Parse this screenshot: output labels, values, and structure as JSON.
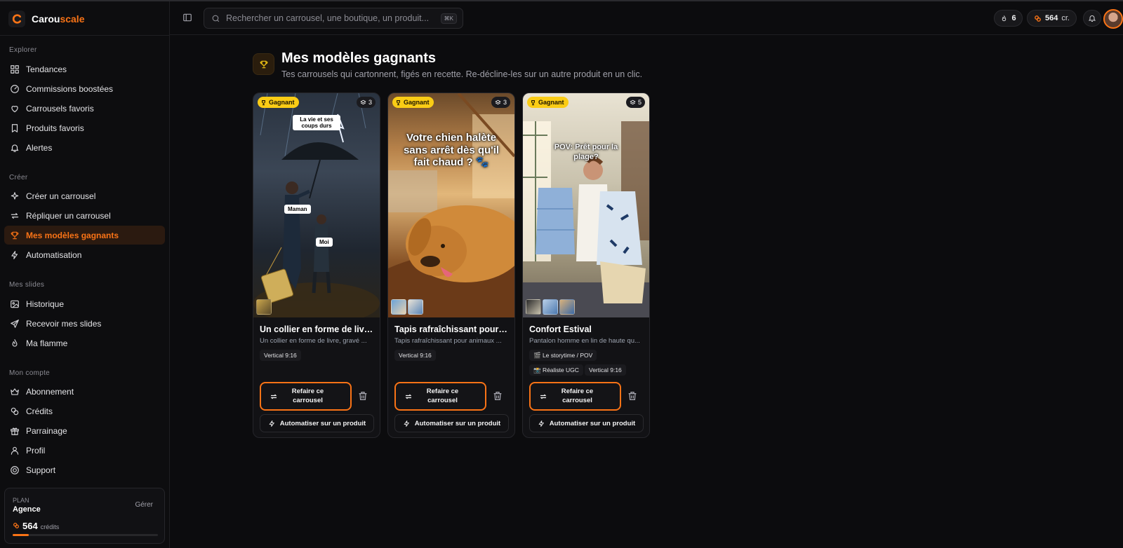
{
  "brand": {
    "name_a": "Carou",
    "name_b": "scale"
  },
  "search": {
    "placeholder": "Rechercher un carrousel, une boutique, un produit...",
    "shortcut": "⌘K"
  },
  "topbar": {
    "flame_count": "6",
    "credits": "564",
    "credits_unit": "cr."
  },
  "sidebar": {
    "sections": [
      {
        "title": "Explorer",
        "items": [
          {
            "label": "Tendances",
            "icon": "grid-icon"
          },
          {
            "label": "Commissions boostées",
            "icon": "gauge-icon"
          },
          {
            "label": "Carrousels favoris",
            "icon": "heart-icon"
          },
          {
            "label": "Produits favoris",
            "icon": "bookmark-icon"
          },
          {
            "label": "Alertes",
            "icon": "bell-icon"
          }
        ]
      },
      {
        "title": "Créer",
        "items": [
          {
            "label": "Créer un carrousel",
            "icon": "sparkles-icon"
          },
          {
            "label": "Répliquer un carrousel",
            "icon": "repeat-icon"
          },
          {
            "label": "Mes modèles gagnants",
            "icon": "trophy-icon",
            "active": true
          },
          {
            "label": "Automatisation",
            "icon": "bolt-icon"
          }
        ]
      },
      {
        "title": "Mes slides",
        "items": [
          {
            "label": "Historique",
            "icon": "image-icon"
          },
          {
            "label": "Recevoir mes slides",
            "icon": "send-icon"
          },
          {
            "label": "Ma flamme",
            "icon": "flame-icon"
          }
        ]
      },
      {
        "title": "Mon compte",
        "items": [
          {
            "label": "Abonnement",
            "icon": "crown-icon"
          },
          {
            "label": "Crédits",
            "icon": "coins-icon"
          },
          {
            "label": "Parrainage",
            "icon": "gift-icon"
          },
          {
            "label": "Profil",
            "icon": "user-icon"
          },
          {
            "label": "Support",
            "icon": "lifebuoy-icon"
          }
        ]
      }
    ]
  },
  "plan": {
    "label": "PLAN",
    "name": "Agence",
    "manage": "Gérer",
    "credits": "564",
    "credits_unit": "crédits",
    "credits_fill": 0.11
  },
  "page": {
    "title": "Mes modèles gagnants",
    "subtitle": "Tes carrousels qui cartonnent, figés en recette. Re-décline-les sur un autre produit en un clic."
  },
  "cards": [
    {
      "badge": "Gagnant",
      "slides": "3",
      "title": "Un collier en forme de livre...",
      "desc": "Un collier en forme de livre, gravé ...",
      "image_labels": [
        "La vie et ses coups durs",
        "Maman",
        "Moi"
      ],
      "chips": [
        {
          "label": "Vertical 9:16"
        }
      ],
      "redo": "Refaire ce carrousel",
      "auto": "Automatiser sur un produit"
    },
    {
      "badge": "Gagnant",
      "slides": "3",
      "title": "Tapis rafraîchissant pour a...",
      "desc": "Tapis rafraîchissant pour animaux ...",
      "image_text": "Votre chien halète sans arrêt dès qu'il fait chaud ? 🐾",
      "chips": [
        {
          "label": "Vertical 9:16"
        }
      ],
      "redo": "Refaire ce carrousel",
      "auto": "Automatiser sur un produit"
    },
    {
      "badge": "Gagnant",
      "slides": "5",
      "title": "Confort Estival",
      "desc": "Pantalon homme en lin de haute qu...",
      "image_text": "POV: Prêt pour la plage?",
      "chips": [
        {
          "label": "🎬 Le storytime / POV"
        },
        {
          "label": "📸 Réaliste UGC"
        },
        {
          "label": "Vertical 9:16"
        }
      ],
      "redo": "Refaire ce carrousel",
      "auto": "Automatiser sur un produit"
    }
  ],
  "colors": {
    "accent": "#f97316",
    "badge": "#facc15",
    "background": "#0c0c0e"
  }
}
